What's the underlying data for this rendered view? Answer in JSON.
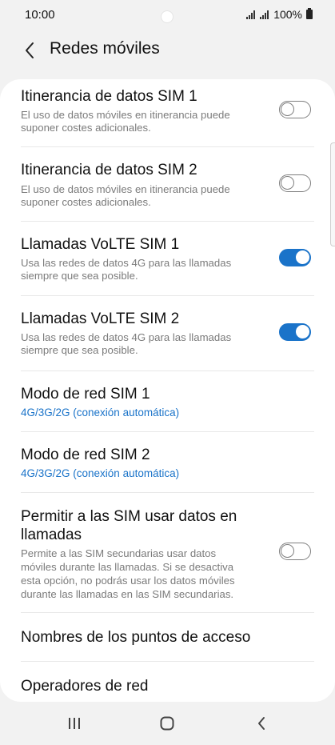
{
  "status_bar": {
    "time": "10:00",
    "battery_text": "100%",
    "icons": [
      "signal-icon",
      "signal-icon",
      "battery-icon"
    ]
  },
  "header": {
    "title": "Redes móviles",
    "back_icon": "chevron-left-icon"
  },
  "colors": {
    "accent": "#1a73c9",
    "toggle_off": "#7f7f7f",
    "background": "#f2f2f2",
    "card": "#ffffff"
  },
  "settings": [
    {
      "title": "Itinerancia de datos SIM 1",
      "desc_line1": "El uso de datos móviles en itinerancia puede",
      "desc_line2": "suponer costes adicionales.",
      "toggle": false
    },
    {
      "title": "Itinerancia de datos SIM 2",
      "desc_line1": "El uso de datos móviles en itinerancia puede",
      "desc_line2": "suponer costes adicionales.",
      "toggle": false
    },
    {
      "title": "Llamadas VoLTE SIM 1",
      "desc_line1": "Usa las redes de datos 4G para las llamadas",
      "desc_line2": "siempre que sea posible.",
      "toggle": true
    },
    {
      "title": "Llamadas VoLTE SIM 2",
      "desc_line1": "Usa las redes de datos 4G para las llamadas",
      "desc_line2": "siempre que sea posible.",
      "toggle": true
    },
    {
      "title": "Modo de red SIM 1",
      "subtitle": "4G/3G/2G (conexión automática)"
    },
    {
      "title": "Modo de red SIM 2",
      "subtitle": "4G/3G/2G (conexión automática)"
    },
    {
      "title_line1": "Permitir a las SIM usar datos en",
      "title_line2": "llamadas",
      "desc_line1": "Permite a las SIM secundarias usar datos",
      "desc_line2": "móviles durante las llamadas. Si se desactiva",
      "desc_line3": "esta opción, no podrás usar los datos móviles",
      "desc_line4": "durante las llamadas en las SIM secundarias.",
      "toggle": false
    },
    {
      "title": "Nombres de los puntos de acceso"
    },
    {
      "title": "Operadores de red"
    }
  ],
  "nav_bar": {
    "recents_icon": "recents-icon",
    "home_icon": "home-icon",
    "back_icon": "back-icon"
  }
}
